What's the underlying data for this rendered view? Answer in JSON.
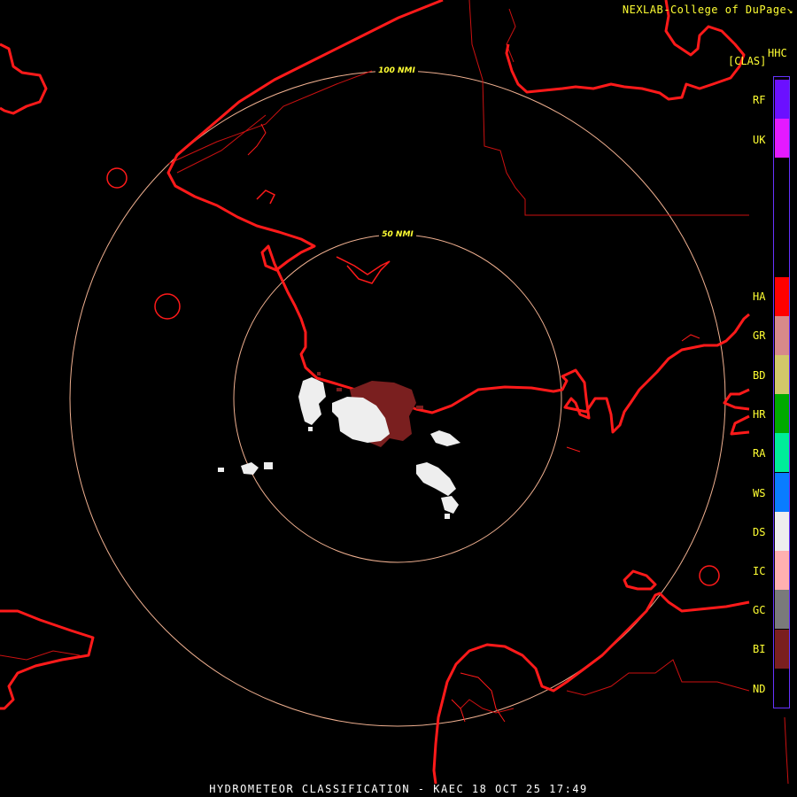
{
  "credit": "NEXLAB-College of DuPage",
  "credit_glyph": "↘",
  "product_code": "HHC",
  "class_header": "[CLAS]",
  "range_rings": [
    {
      "label": "100 NMI"
    },
    {
      "label": "50 NMI"
    }
  ],
  "legend": [
    {
      "code": "RF",
      "color": "#6b10ff"
    },
    {
      "code": "UK",
      "color": "#e41aff"
    },
    {
      "code": "HA",
      "color": "#ff0000"
    },
    {
      "code": "GR",
      "color": "#d78a8a"
    },
    {
      "code": "BD",
      "color": "#d2c86a"
    },
    {
      "code": "HR",
      "color": "#00aa00"
    },
    {
      "code": "RA",
      "color": "#00ee99"
    },
    {
      "code": "WS",
      "color": "#0a7cff"
    },
    {
      "code": "DS",
      "color": "#eeeeee"
    },
    {
      "code": "IC",
      "color": "#ffb0b0"
    },
    {
      "code": "GC",
      "color": "#7a7a7a"
    },
    {
      "code": "BI",
      "color": "#7a1f1f"
    },
    {
      "code": "ND",
      "color": "#000000"
    }
  ],
  "colors": {
    "coastline": "#ff1a1a",
    "boundary": "#cc1111",
    "range_ring": "#f0b090",
    "text": "#ffff33",
    "dry_snow": "#eeeeee",
    "biological": "#7a1f1f"
  },
  "footer": {
    "product": "HYDROMETEOR CLASSIFICATION",
    "separator": "-",
    "station": "KAEC",
    "datetime": "18 OCT 25 17:49"
  }
}
